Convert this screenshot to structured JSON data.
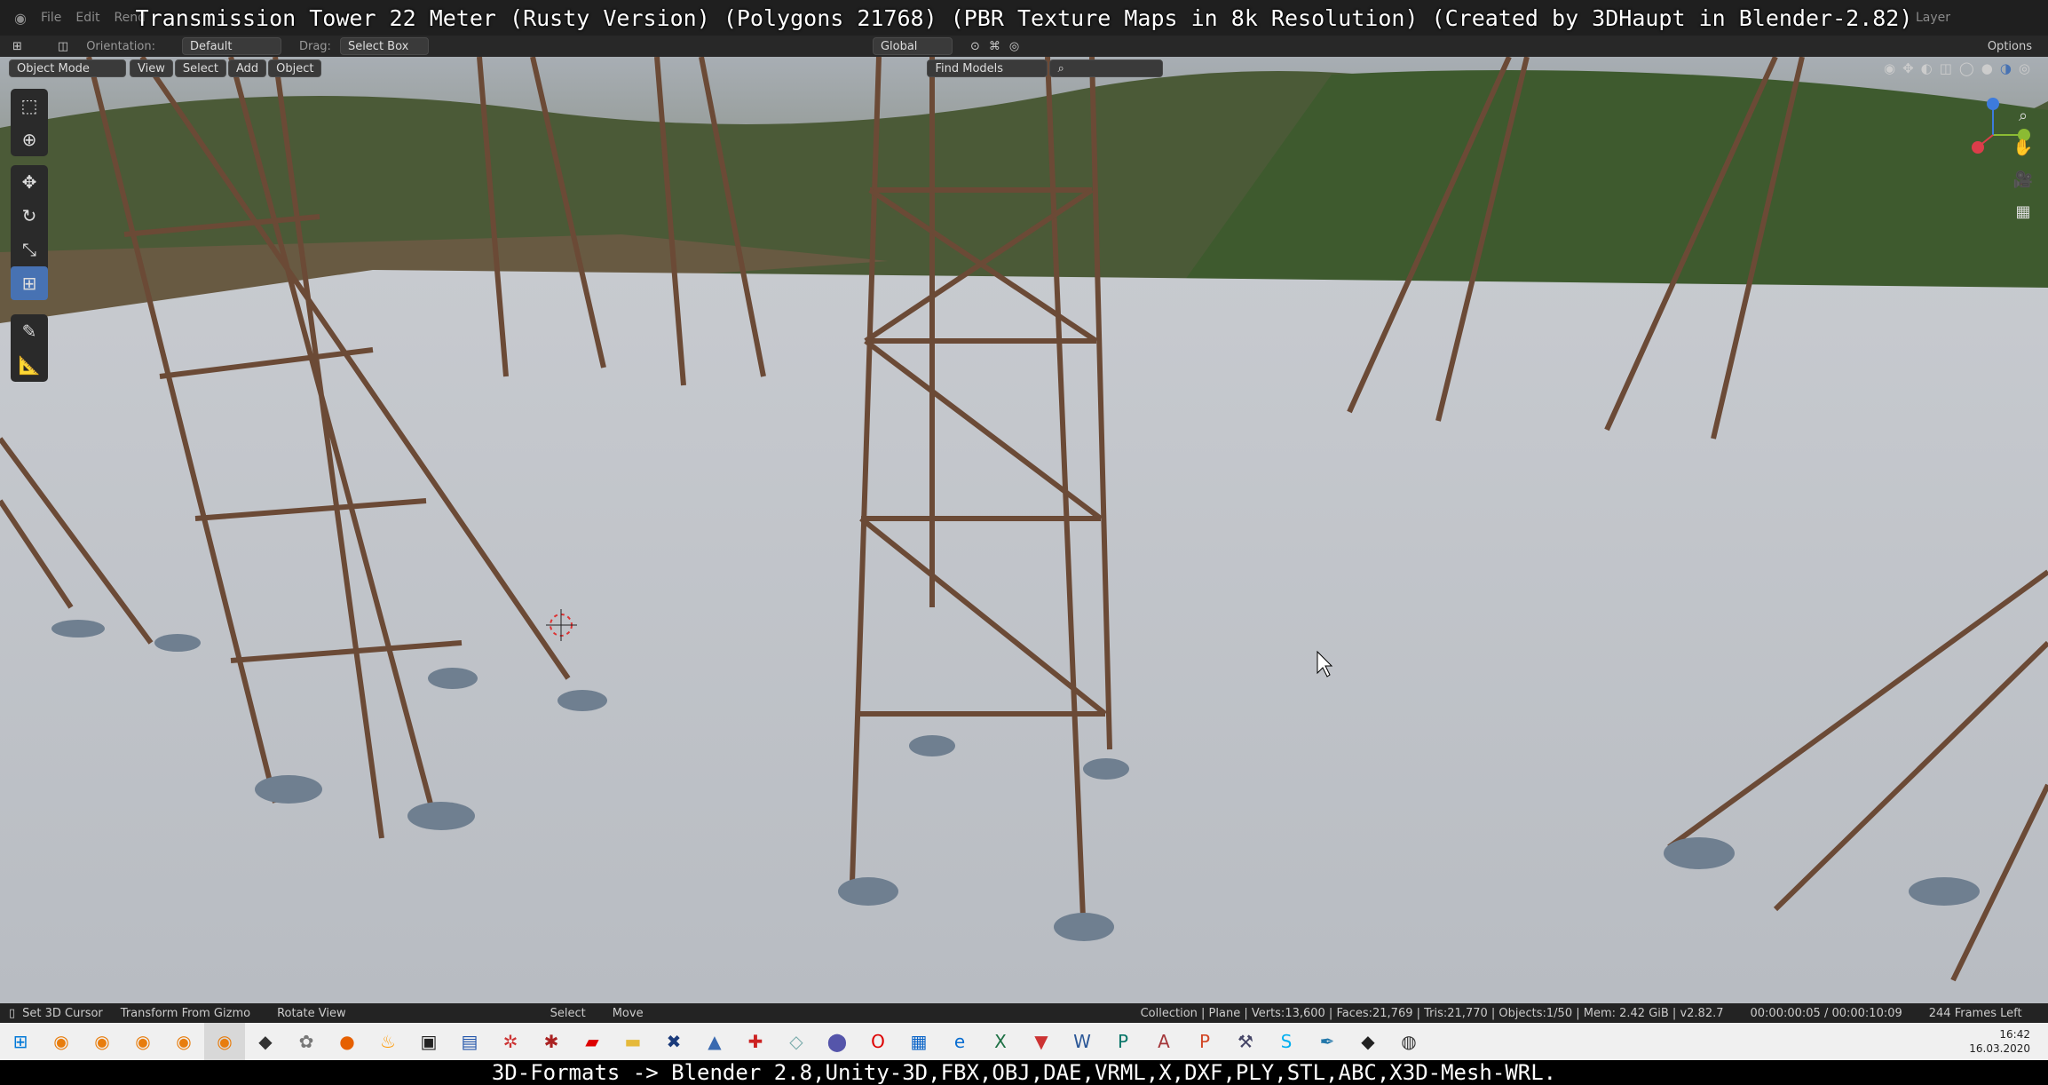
{
  "top": {
    "menus": [
      "File",
      "Edit",
      "Rend"
    ],
    "watermark": "Transmission Tower 22 Meter (Rusty Version) (Polygons 21768) (PBR Texture Maps in 8k Resolution) (Created by 3DHaupt in Blender-2.82)",
    "layer": "Layer"
  },
  "header": {
    "orientation_label": "Orientation:",
    "orientation_value": "Default",
    "drag_label": "Drag:",
    "drag_value": "Select Box",
    "transform_value": "Global",
    "options": "Options"
  },
  "viewport_header": {
    "mode": "Object Mode",
    "menus": [
      "View",
      "Select",
      "Add",
      "Object"
    ],
    "find_models": "Find Models"
  },
  "status": {
    "left1": "Set 3D Cursor",
    "left2": "Transform From Gizmo",
    "left3": "Rotate View",
    "mid1": "Select",
    "mid2": "Move",
    "info": "Collection | Plane | Verts:13,600 | Faces:21,769 | Tris:21,770 | Objects:1/50 | Mem: 2.42 GiB | v2.82.7",
    "time": "00:00:00:05 / 00:00:10:09",
    "frames": "244 Frames Left"
  },
  "taskbar": {
    "time": "16:42",
    "date": "16.03.2020"
  },
  "bottom_caption": "3D-Formats -> Blender 2.8,Unity-3D,FBX,OBJ,DAE,VRML,X,DXF,PLY,STL,ABC,X3D-Mesh-WRL.",
  "colors": {
    "accent": "#4772b3",
    "ground": "#c9ccd0",
    "rust": "#8a4a2a"
  }
}
